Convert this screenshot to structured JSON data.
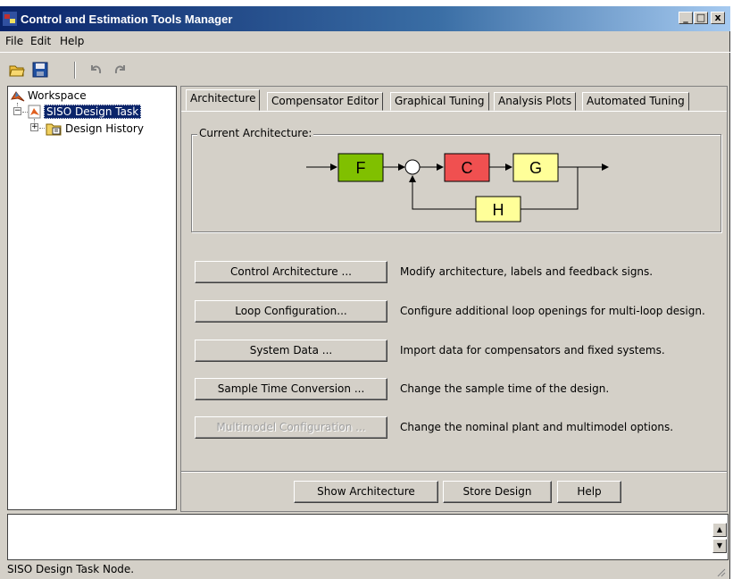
{
  "window": {
    "title": "Control and Estimation Tools Manager",
    "controls": {
      "minimize": "_",
      "maximize": "□",
      "close": "x"
    }
  },
  "menu": [
    "File",
    "Edit",
    "Help"
  ],
  "toolbar": {
    "icons": [
      "open-folder-icon",
      "save-icon",
      "undo-icon",
      "redo-icon"
    ]
  },
  "tree": {
    "root": "Workspace",
    "task": "SISO Design Task",
    "child": "Design History",
    "expander_open": "−",
    "expander_closed": "+"
  },
  "tabs": [
    {
      "label": "Architecture",
      "active": true
    },
    {
      "label": "Compensator Editor",
      "active": false
    },
    {
      "label": "Graphical Tuning",
      "active": false
    },
    {
      "label": "Analysis Plots",
      "active": false
    },
    {
      "label": "Automated Tuning",
      "active": false
    }
  ],
  "architecture": {
    "group_label": "Current Architecture:",
    "blocks": {
      "F": "F",
      "C": "C",
      "G": "G",
      "H": "H"
    },
    "colors": {
      "F": "#80c000",
      "C": "#f05050",
      "G": "#ffff99",
      "H": "#ffff99"
    }
  },
  "actions": [
    {
      "button": "Control Architecture ...",
      "description": "Modify architecture, labels and feedback signs.",
      "enabled": true
    },
    {
      "button": "Loop Configuration...",
      "description": "Configure additional loop openings for multi-loop design.",
      "enabled": true
    },
    {
      "button": "System Data ...",
      "description": "Import data for compensators and fixed systems.",
      "enabled": true
    },
    {
      "button": "Sample Time Conversion ...",
      "description": "Change the sample time of the design.",
      "enabled": true
    },
    {
      "button": "Multimodel Configuration ...",
      "description": "Change the nominal plant and multimodel options.",
      "enabled": false
    }
  ],
  "footer_buttons": {
    "show": "Show Architecture",
    "store": "Store Design",
    "help": "Help"
  },
  "log": {
    "up": "▲",
    "down": "▼"
  },
  "status": "SISO Design Task Node."
}
